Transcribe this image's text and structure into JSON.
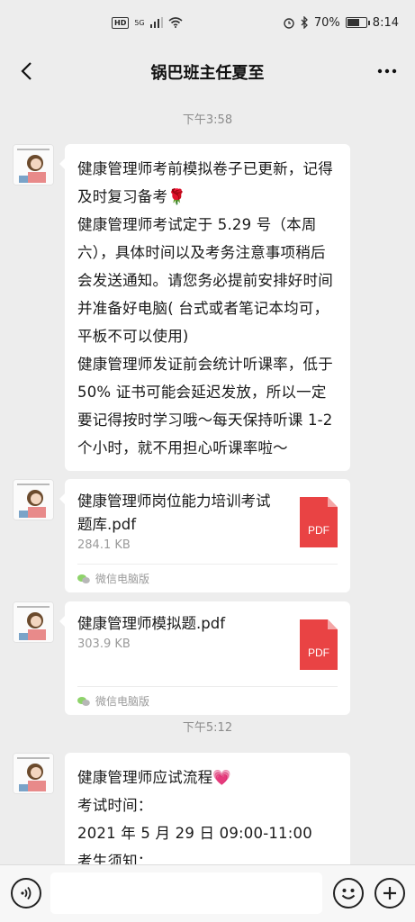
{
  "status_bar": {
    "hd": "HD",
    "network": "5G",
    "battery": "70%",
    "battery_level": 0.7,
    "time": "8:14"
  },
  "header": {
    "title": "锅巴班主任夏至"
  },
  "messages": [
    {
      "type": "time",
      "text": "下午3:58"
    },
    {
      "type": "text",
      "lines": [
        "健康管理师考前模拟卷子已更新，记得及时复习备考🌹",
        "健康管理师考试定于 5.29 号（本周六），具体时间以及考务注意事项稍后会发送通知。请您务必提前安排好时间并准备好电脑( 台式或者笔记本均可，平板不可以使用)",
        "健康管理师发证前会统计听课率，低于 50% 证书可能会延迟发放，所以一定要记得按时学习哦～每天保持听课 1-2 个小时，就不用担心听课率啦～"
      ]
    },
    {
      "type": "file",
      "name": "健康管理师岗位能力培训考试题库.pdf",
      "size": "284.1 KB",
      "icon_text": "PDF",
      "source": "微信电脑版"
    },
    {
      "type": "file",
      "name": "健康管理师模拟题.pdf",
      "size": "303.9 KB",
      "icon_text": "PDF",
      "source": "微信电脑版"
    },
    {
      "type": "time",
      "text": "下午5:12"
    },
    {
      "type": "text",
      "lines": [
        "健康管理师应试流程💗",
        "考试时间：",
        "2021 年 5 月 29 日 09:00-11:00",
        "考生须知："
      ]
    }
  ],
  "colors": {
    "background": "#ededed",
    "bubble": "#ffffff",
    "pdf": "#e94344",
    "secondary_text": "#9a9a9a"
  },
  "icons": [
    "back-arrow-icon",
    "more-icon",
    "voice-icon",
    "emoji-icon",
    "plus-icon",
    "wechat-pc-icon",
    "pdf-file-icon"
  ]
}
